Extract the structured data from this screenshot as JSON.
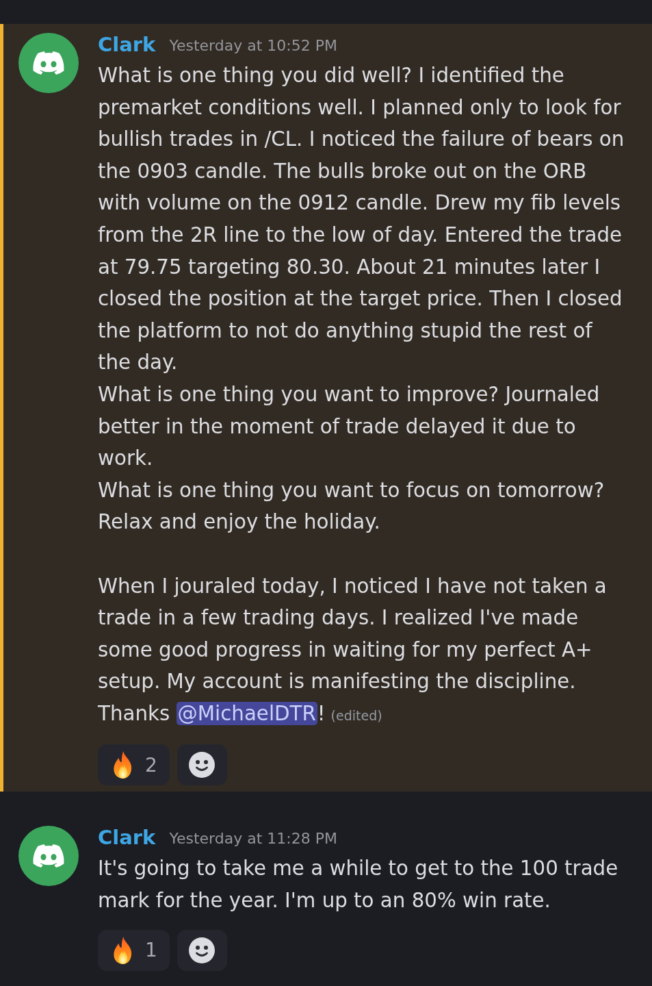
{
  "messages": [
    {
      "author": "Clark",
      "timestamp": "Yesterday at 10:52 PM",
      "highlighted": true,
      "content": [
        {
          "kind": "text",
          "text": "What is one thing you did well? I identified the premarket conditions well. I planned only to look for bullish trades in /CL. I noticed the failure of bears on the 0903 candle. The bulls broke out on the ORB with volume on the 0912 candle. Drew my fib levels from the 2R line to the low of day. Entered the trade at 79.75 targeting 80.30. About 21 minutes later I closed the position at the target price. Then I closed the platform to not do anything stupid the rest of the day.\nWhat is one thing you want to improve? Journaled better in the moment of trade delayed it due to work.\nWhat is one thing you want to focus on tomorrow? Relax and enjoy the holiday.\n\nWhen I jouraled today, I noticed I have not taken a trade in a few trading days. I realized I've made some good progress in waiting for my perfect A+ setup. My account is manifesting the discipline. Thanks "
        },
        {
          "kind": "mention",
          "text": "@MichaelDTR"
        },
        {
          "kind": "text",
          "text": "!"
        }
      ],
      "edited": "(edited)",
      "reactions": [
        {
          "count": "2"
        }
      ]
    },
    {
      "author": "Clark",
      "timestamp": "Yesterday at 11:28 PM",
      "highlighted": false,
      "content": [
        {
          "kind": "text",
          "text": "It's going to take me a while to get to the 100 trade mark for the year. I'm up to an 80% win rate."
        }
      ],
      "reactions": [
        {
          "count": "1"
        }
      ]
    }
  ]
}
